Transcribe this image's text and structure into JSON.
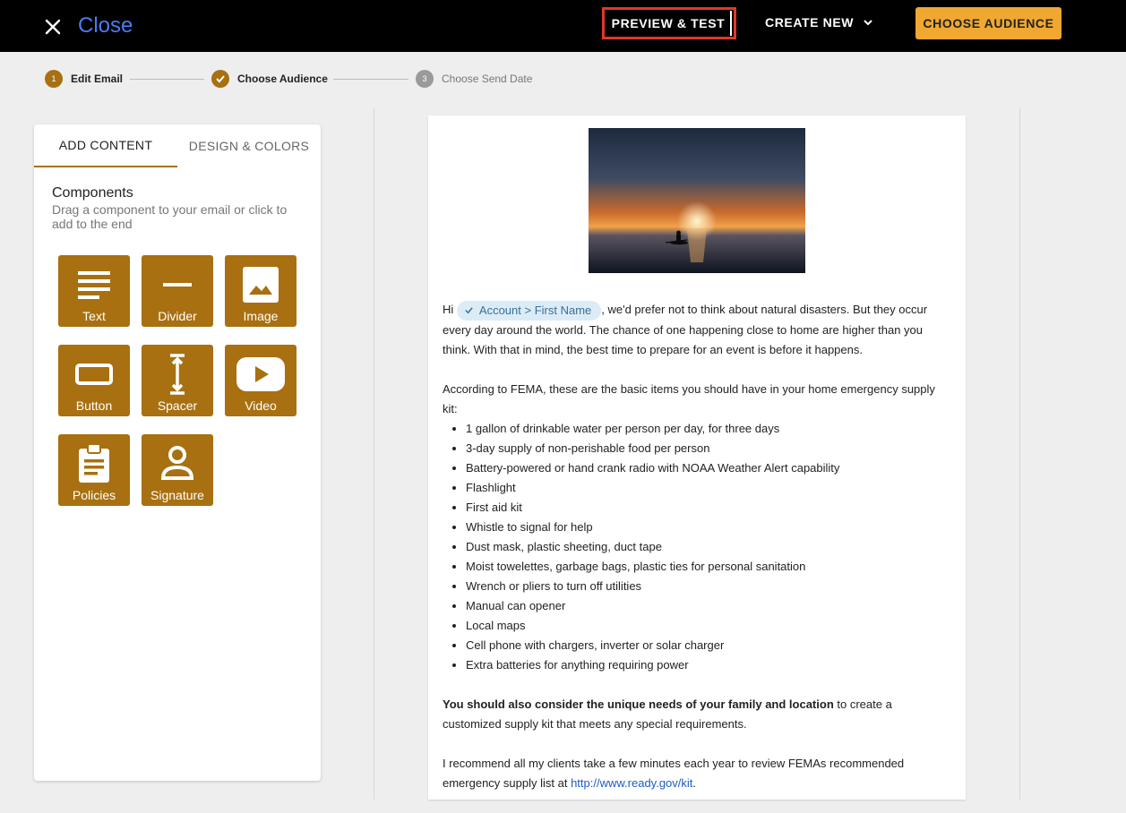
{
  "topbar": {
    "close_label": "Close",
    "preview_label": "PREVIEW & TEST",
    "create_new_label": "CREATE NEW",
    "choose_audience_label": "CHOOSE AUDIENCE",
    "accent_color": "#f0a830"
  },
  "stepper": {
    "steps": [
      {
        "number": "1",
        "label": "Edit Email",
        "state": "current"
      },
      {
        "number": "",
        "label": "Choose Audience",
        "state": "done"
      },
      {
        "number": "3",
        "label": "Choose Send Date",
        "state": "upcoming"
      }
    ]
  },
  "left_panel": {
    "tabs": [
      {
        "label": "ADD CONTENT",
        "active": true
      },
      {
        "label": "DESIGN & COLORS",
        "active": false
      }
    ],
    "components_title": "Components",
    "components_desc": "Drag a component to your email or click to add to the end",
    "tile_color": "#a87010",
    "components": [
      {
        "label": "Text",
        "icon": "text-icon"
      },
      {
        "label": "Divider",
        "icon": "divider-icon"
      },
      {
        "label": "Image",
        "icon": "image-icon"
      },
      {
        "label": "Button",
        "icon": "button-icon"
      },
      {
        "label": "Spacer",
        "icon": "spacer-icon"
      },
      {
        "label": "Video",
        "icon": "video-icon"
      },
      {
        "label": "Policies",
        "icon": "policies-icon"
      },
      {
        "label": "Signature",
        "icon": "signature-icon"
      }
    ]
  },
  "email": {
    "greeting_prefix": "Hi",
    "merge_field": "Account > First Name",
    "intro_rest": ", we'd prefer not to think about natural disasters. But they occur every day around the world. The chance of one happening close to home are higher than you think. With that in mind, the best time to prepare for an event is before it happens.",
    "list_intro": "According to FEMA, these are the basic items you should have in your home emergency supply kit:",
    "supply_items": [
      "1 gallon of drinkable water per person per day, for three days",
      "3-day supply of non-perishable food per person",
      "Battery-powered or hand crank radio with NOAA Weather Alert capability",
      "Flashlight",
      "First aid kit",
      "Whistle to signal for help",
      "Dust mask, plastic sheeting, duct tape",
      "Moist towelettes, garbage bags, plastic ties for personal sanitation",
      "Wrench or pliers to turn off utilities",
      "Manual can opener",
      "Local maps",
      "Cell phone with chargers, inverter or solar charger",
      "Extra batteries for anything requiring power"
    ],
    "bold_text": "You should also consider the unique needs of your family and location",
    "bold_rest": " to create a customized supply kit that meets any special requirements.",
    "closing_prefix": "I recommend all my clients take a few minutes each year to review FEMAs recommended emergency supply list at ",
    "closing_link": "http://www.ready.gov/kit",
    "closing_suffix": "."
  }
}
